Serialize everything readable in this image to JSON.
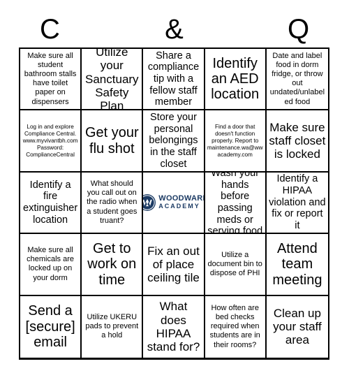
{
  "card": {
    "title_letters": [
      "C",
      "",
      "&",
      "",
      "Q"
    ],
    "grid_size": "5x5"
  },
  "colors": {
    "border": "#000000",
    "text": "#000000",
    "logo_navy": "#1b3a63",
    "background": "#ffffff"
  },
  "logo": {
    "name": "woodward-academy-logo",
    "line1": "WOODWARD",
    "line2": "ACADEMY"
  },
  "cells": [
    {
      "id": "r1c1",
      "text": "Make sure all student bathroom stalls have toilet paper on dispensers",
      "size": "sm"
    },
    {
      "id": "r1c2",
      "text": "Utilize your Sanctuary Safety Plan",
      "size": "lg"
    },
    {
      "id": "r1c3",
      "text": "Share a compliance tip with a fellow staff member",
      "size": "md"
    },
    {
      "id": "r1c4",
      "text": "Identify an AED location",
      "size": "xl"
    },
    {
      "id": "r1c5",
      "text": "Date and label food in dorm fridge, or throw out undated/unlabeled food",
      "size": "sm"
    },
    {
      "id": "r2c1",
      "text": "Log in and explore Compliance Central. www.myvivantbh.com Password: ComplianceCentral",
      "size": "xs"
    },
    {
      "id": "r2c2",
      "text": "Get your flu shot",
      "size": "xl"
    },
    {
      "id": "r2c3",
      "text": "Store your personal belongings in the staff closet",
      "size": "md"
    },
    {
      "id": "r2c4",
      "text": "Find a door that doesn't function properly. Report to maintenance.wa@wwacademy.com",
      "size": "xs"
    },
    {
      "id": "r2c5",
      "text": "Make sure staff closet is locked",
      "size": "lg"
    },
    {
      "id": "r3c1",
      "text": "Identify a fire extinguisher location",
      "size": "md"
    },
    {
      "id": "r3c2",
      "text": "What should you call out on the radio when a student goes truant?",
      "size": "sm"
    },
    {
      "id": "r3c3",
      "text": "",
      "size": "md",
      "is_logo": true
    },
    {
      "id": "r3c4",
      "text": "Wash your hands before passing meds or serving food",
      "size": "md"
    },
    {
      "id": "r3c5",
      "text": "Identify a HIPAA violation and fix or report it",
      "size": "md"
    },
    {
      "id": "r4c1",
      "text": "Make sure all chemicals are locked up on your dorm",
      "size": "sm"
    },
    {
      "id": "r4c2",
      "text": "Get to work on time",
      "size": "xl"
    },
    {
      "id": "r4c3",
      "text": "Fix an out of place ceiling tile",
      "size": "lg"
    },
    {
      "id": "r4c4",
      "text": "Utilize a document bin to dispose of PHI",
      "size": "sm"
    },
    {
      "id": "r4c5",
      "text": "Attend team meeting",
      "size": "xl"
    },
    {
      "id": "r5c1",
      "text": "Send a [secure] email",
      "size": "xl"
    },
    {
      "id": "r5c2",
      "text": "Utilize UKERU pads to prevent a hold",
      "size": "sm"
    },
    {
      "id": "r5c3",
      "text": "What does HIPAA stand for?",
      "size": "lg"
    },
    {
      "id": "r5c4",
      "text": "How often are bed checks required when students are in their rooms?",
      "size": "sm"
    },
    {
      "id": "r5c5",
      "text": "Clean up your staff area",
      "size": "lg"
    }
  ]
}
